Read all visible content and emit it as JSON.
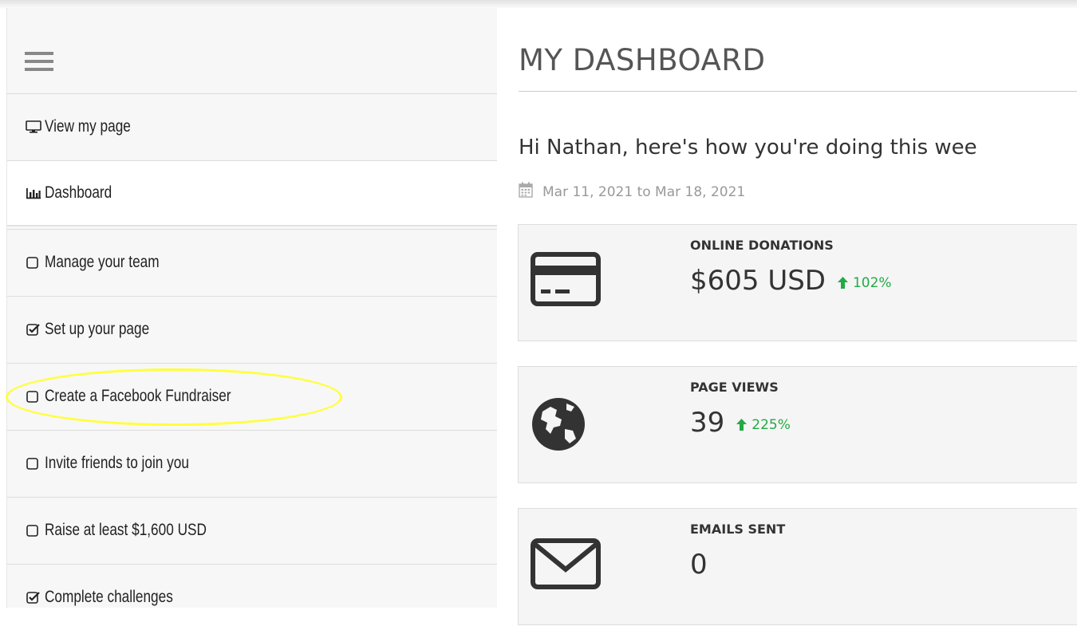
{
  "sidebar": {
    "items": [
      {
        "label": "View my page",
        "icon": "monitor-icon",
        "active": false
      },
      {
        "label": "Dashboard",
        "icon": "bar-chart-icon",
        "active": true
      },
      {
        "label": "Manage your team",
        "icon": "checkbox-empty-icon",
        "active": false
      },
      {
        "label": "Set up your page",
        "icon": "checkbox-checked-icon",
        "active": false
      },
      {
        "label": "Create a Facebook Fundraiser",
        "icon": "checkbox-empty-icon",
        "active": false
      },
      {
        "label": "Invite friends to join you",
        "icon": "checkbox-empty-icon",
        "active": false
      },
      {
        "label": "Raise at least $1,600 USD",
        "icon": "checkbox-empty-icon",
        "active": false
      },
      {
        "label": "Complete challenges",
        "icon": "checkbox-checked-icon",
        "active": false
      }
    ],
    "highlight_color": "#ffff3c"
  },
  "main": {
    "title": "MY DASHBOARD",
    "greeting": "Hi Nathan, here's how you're doing this wee",
    "date_range": "Mar 11, 2021 to Mar 18, 2021",
    "cards": [
      {
        "label": "ONLINE DONATIONS",
        "value": "$605 USD",
        "delta": "102%",
        "icon": "credit-card-icon"
      },
      {
        "label": "PAGE VIEWS",
        "value": "39",
        "delta": "225%",
        "icon": "globe-icon"
      },
      {
        "label": "EMAILS SENT",
        "value": "0",
        "delta": "",
        "icon": "envelope-icon"
      }
    ]
  },
  "colors": {
    "positive": "#22aa44",
    "sidebar_bg": "#f7f7f7",
    "card_bg": "#f5f5f5"
  }
}
